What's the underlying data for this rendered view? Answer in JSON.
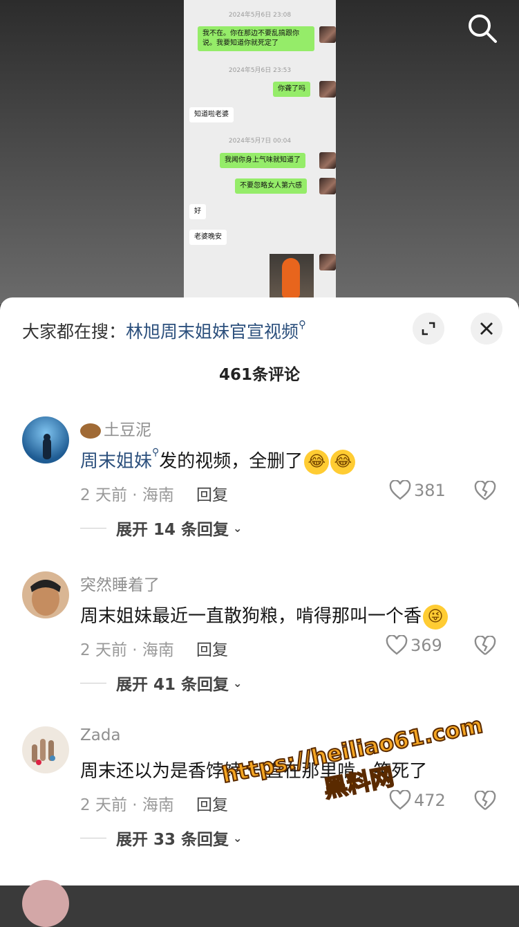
{
  "chat_screenshot": {
    "messages": [
      {
        "type": "time",
        "text": "2024年5月6日 23:08"
      },
      {
        "type": "me",
        "text": "我不在。你在那边不要乱搞跟你\n说。我要知道你就死定了"
      },
      {
        "type": "time",
        "text": "2024年5月6日 23:53"
      },
      {
        "type": "me",
        "text": "你聋了吗"
      },
      {
        "type": "them",
        "text": "知道啦老婆"
      },
      {
        "type": "time",
        "text": "2024年5月7日 00:04"
      },
      {
        "type": "me",
        "text": "我闻你身上气味就知道了"
      },
      {
        "type": "me",
        "text": "不要忽略女人第六感"
      },
      {
        "type": "them",
        "text": "好"
      },
      {
        "type": "them",
        "text": "老婆晚安"
      }
    ]
  },
  "top": {
    "search_icon": "search-icon"
  },
  "panel": {
    "hot_prefix": "大家都在搜：",
    "hot_link": "林旭周末姐妹官宣视频",
    "count_label": "461条评论",
    "expand_icon": "expand-icon",
    "close_icon": "close-icon"
  },
  "comments": [
    {
      "name": "土豆泥",
      "link": "周末姐妹",
      "text": "发的视频，全删了",
      "meta": "2 天前 · 海南",
      "reply": "回复",
      "likes": "381",
      "expand": "展开 14 条回复"
    },
    {
      "name": "突然睡着了",
      "text": "周末姐妹最近一直散狗粮，啃得那叫一个香",
      "meta": "2 天前 · 海南",
      "reply": "回复",
      "likes": "369",
      "expand": "展开 41 条回复"
    },
    {
      "name": "Zada",
      "text": "周末还以为是香饽饽 一直在那里啃，笑死了",
      "meta": "2 天前 · 海南",
      "reply": "回复",
      "likes": "472",
      "expand": "展开 33 条回复"
    }
  ],
  "watermark": {
    "url": "https://heiliao61.com",
    "cn": "黑料网"
  }
}
